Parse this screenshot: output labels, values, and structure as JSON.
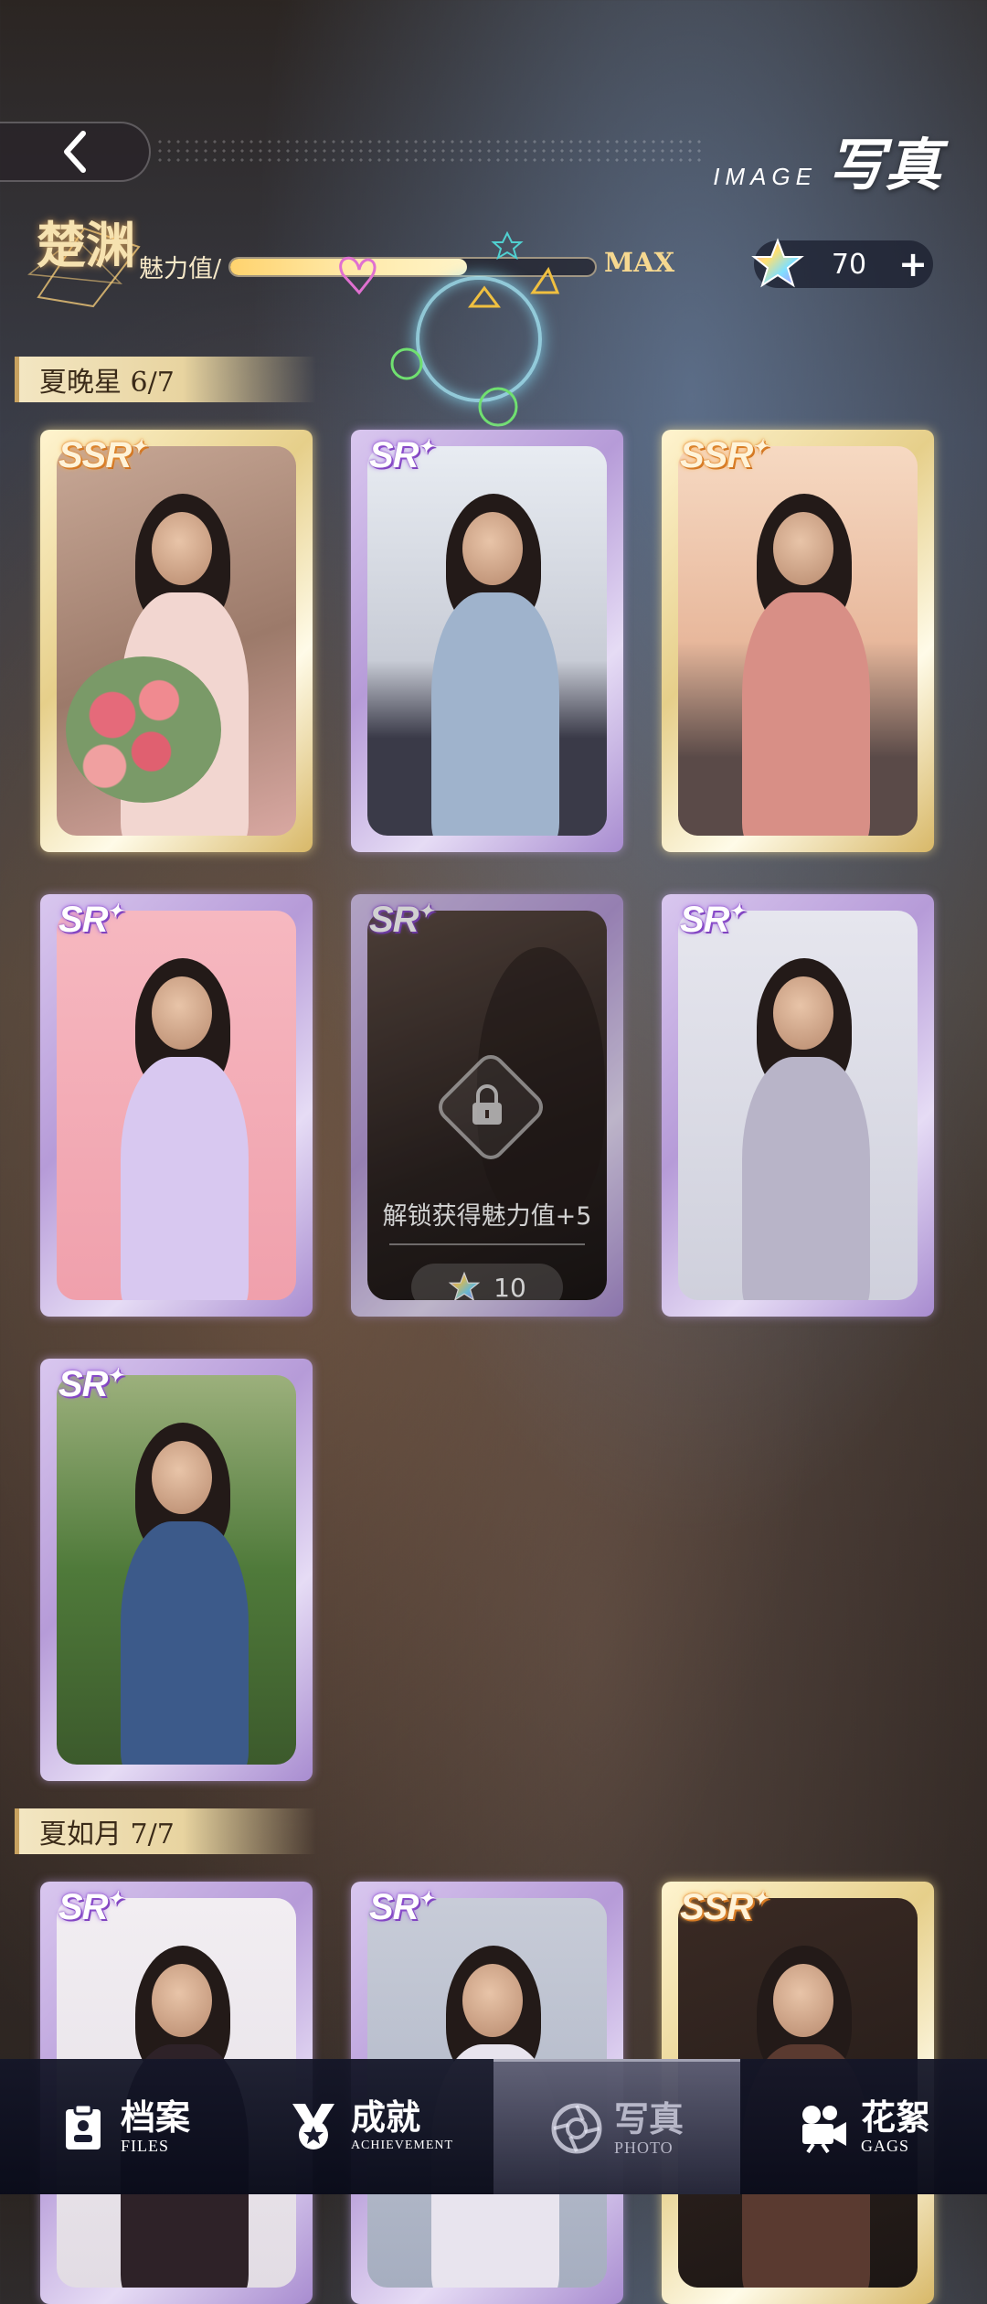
{
  "header": {
    "title_en": "IMAGE",
    "title_cn": "写真"
  },
  "character": {
    "name": "楚渊",
    "charm_label": "魅力值/",
    "charm_status": "MAX",
    "charm_progress": 0.65
  },
  "currency": {
    "icon": "rainbow-star-icon",
    "value": "70",
    "plus_label": "+"
  },
  "sections": [
    {
      "title": "夏晚星 6/7",
      "cards": [
        {
          "rarity": "SSR",
          "locked": false
        },
        {
          "rarity": "SR",
          "locked": false
        },
        {
          "rarity": "SSR",
          "locked": false
        },
        {
          "rarity": "SR",
          "locked": false
        },
        {
          "rarity": "SR",
          "locked": true,
          "unlock_text": "解锁获得魅力值+5",
          "cost": "10"
        },
        {
          "rarity": "SR",
          "locked": false
        },
        {
          "rarity": "SR",
          "locked": false
        }
      ]
    },
    {
      "title": "夏如月 7/7",
      "cards": [
        {
          "rarity": "SR",
          "locked": false
        },
        {
          "rarity": "SR",
          "locked": false
        },
        {
          "rarity": "SSR",
          "locked": false
        }
      ]
    }
  ],
  "nav": [
    {
      "cn": "档案",
      "en": "FILES",
      "icon": "clipboard-icon",
      "active": false
    },
    {
      "cn": "成就",
      "en": "ACHIEVEMENT",
      "icon": "medal-icon",
      "active": false
    },
    {
      "cn": "写真",
      "en": "PHOTO",
      "icon": "camera-lens-icon",
      "active": true
    },
    {
      "cn": "花絮",
      "en": "GAGS",
      "icon": "film-camera-icon",
      "active": false
    }
  ]
}
